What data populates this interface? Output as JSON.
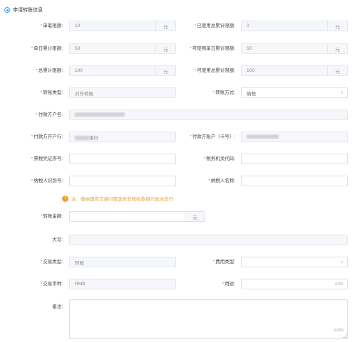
{
  "section": {
    "title": "申请转账信息"
  },
  "fields": {
    "single_limit": {
      "label": "单笔限额:",
      "value": "10",
      "unit": "元"
    },
    "used_total_limit": {
      "label": "已使用总累计限额:",
      "value": "0",
      "unit": "元"
    },
    "daily_limit": {
      "label": "单日累计限额:",
      "value": "50",
      "unit": "元"
    },
    "usable_daily_limit": {
      "label": "可使用单日累计限额:",
      "value": "50",
      "unit": "元"
    },
    "total_limit": {
      "label": "总累计限额:",
      "value": "100",
      "unit": "元"
    },
    "usable_total_limit": {
      "label": "可使用总累计限额:",
      "value": "100",
      "unit": "元"
    },
    "transfer_type": {
      "label": "转账类型:",
      "value": "对外转账"
    },
    "transfer_method": {
      "label": "转账方式:",
      "value": "纳税"
    },
    "payer_name": {
      "label": "付款方户名:",
      "value": ""
    },
    "payer_bank": {
      "label": "付款方开户行:",
      "value": "银行"
    },
    "payer_account": {
      "label": "付款方账户（卡号）:",
      "value": ""
    },
    "tax_voucher_no": {
      "label": "票税凭证序号:",
      "value": ""
    },
    "tax_authority_code": {
      "label": "税务机关代码:",
      "value": ""
    },
    "taxpayer_id": {
      "label": "纳税人识别号:",
      "value": ""
    },
    "taxpayer_name": {
      "label": "纳税人名称:",
      "value": ""
    },
    "transfer_amount": {
      "label": "转账金额:",
      "value": "",
      "unit": "元"
    },
    "amount_uppercase": {
      "label": "大写:",
      "value": ""
    },
    "transaction_type": {
      "label": "交易类型:",
      "value": "转账"
    },
    "fee_type": {
      "label": "费用类型:",
      "value": ""
    },
    "currency": {
      "label": "交易币种:",
      "value": "RMB"
    },
    "purpose": {
      "label": "用途:",
      "value": "",
      "count": "0/20"
    },
    "remarks": {
      "label": "备注:",
      "value": "",
      "count": "0/256"
    }
  },
  "notice": {
    "text": "注：缴纳国库交易时需选择非税收款银行具体支行"
  },
  "colors": {
    "required": "#f56c6c",
    "warning": "#e6a23c",
    "accent": "#409eff"
  }
}
